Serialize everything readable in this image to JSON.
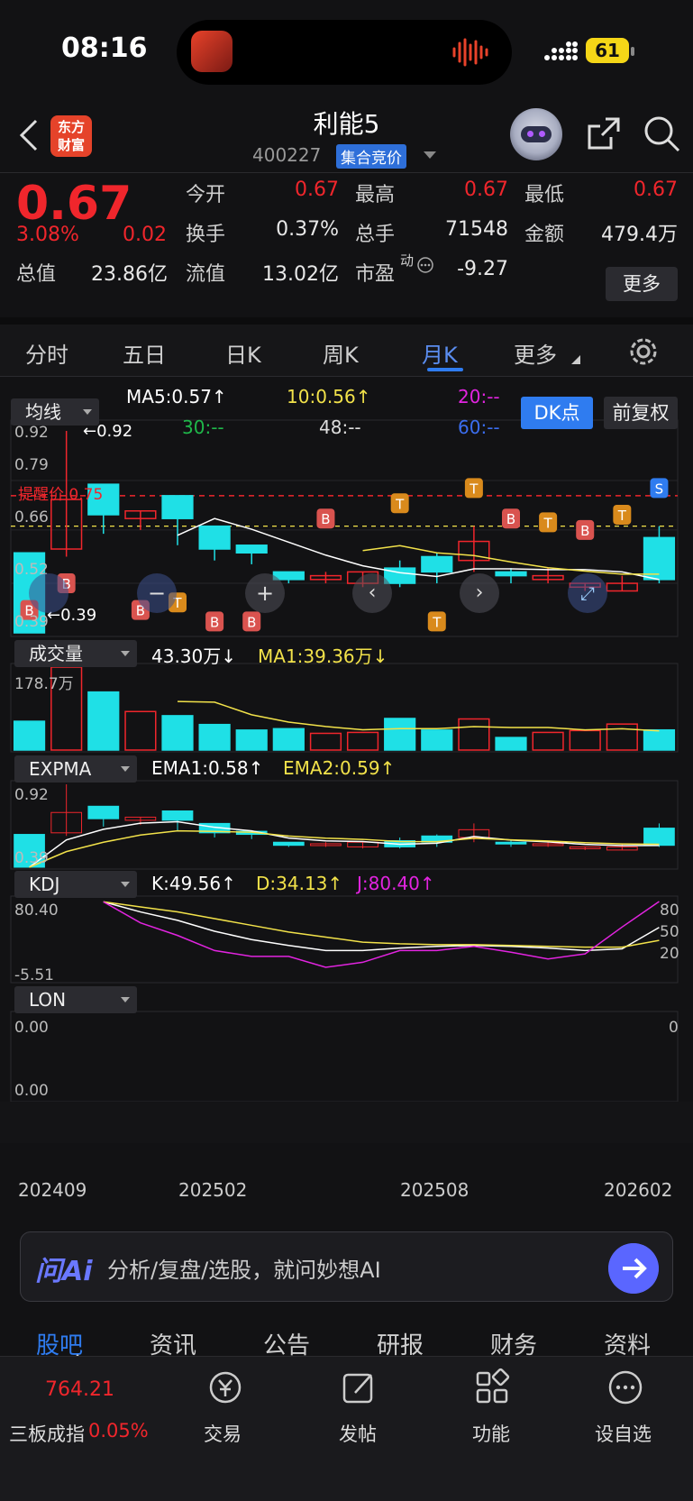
{
  "status": {
    "time": "08:16",
    "battery": "61"
  },
  "header": {
    "title": "利能5",
    "code": "400227",
    "auction_badge": "集合竞价",
    "logo_line1": "东方",
    "logo_line2": "财富"
  },
  "quote": {
    "price": "0.67",
    "change_pct": "3.08%",
    "change": "0.02",
    "open_label": "今开",
    "open": "0.67",
    "high_label": "最高",
    "high": "0.67",
    "low_label": "最低",
    "low": "0.67",
    "turnover_label": "换手",
    "turnover": "0.37%",
    "volume_label": "总手",
    "volume": "71548",
    "amount_label": "金额",
    "amount": "479.4万",
    "mktcap_label": "总值",
    "mktcap": "23.86亿",
    "float_label": "流值",
    "float_cap": "13.02亿",
    "pe_label": "市盈",
    "pe_sup": "动",
    "pe": "-9.27",
    "more_button": "更多"
  },
  "tabs": [
    "分时",
    "五日",
    "日K",
    "周K",
    "月K",
    "更多"
  ],
  "active_tab": "月K",
  "chart": {
    "ma_selector": "均线",
    "ma5": "MA5:0.57↑",
    "ma10": "10:0.56↑",
    "ma20": "20:--",
    "ma30": "30:--",
    "ma48": "48:--",
    "ma60": "60:--",
    "dk_button": "DK点",
    "adjust_button": "前复权",
    "price_axis": [
      "0.92",
      "0.79",
      "0.66",
      "0.52",
      "0.39"
    ],
    "max_marker": "←0.92",
    "min_marker": "←0.39",
    "alert_label": "提醒价 0.75",
    "vol_selector": "成交量",
    "vol_value": "43.30万↓",
    "vol_ma": "MA1:39.36万↓",
    "vol_axis": "178.7万",
    "expma_selector": "EXPMA",
    "ema1": "EMA1:0.58↑",
    "ema2": "EMA2:0.59↑",
    "expma_axis_top": "0.92",
    "expma_axis_bottom": "0.39",
    "kdj_selector": "KDJ",
    "k": "K:49.56↑",
    "d": "D:34.13↑",
    "j": "J:80.40↑",
    "kdj_axis_top": "80.40",
    "kdj_axis_bottom": "-5.51",
    "kdj_right": [
      "80",
      "50",
      "20"
    ],
    "lon_selector": "LON",
    "lon_axis_top": "0.00",
    "lon_axis_bottom": "0.00",
    "lon_right": "0",
    "x_labels": [
      "202409",
      "202502",
      "202508",
      "202602"
    ],
    "marker_labels": {
      "buy": "B",
      "sell": "S",
      "t": "T"
    }
  },
  "chart_data": {
    "type": "candlestick",
    "x": [
      "202409",
      "202410",
      "202411",
      "202412",
      "202501",
      "202502",
      "202503",
      "202504",
      "202505",
      "202506",
      "202507",
      "202508",
      "202509",
      "202510",
      "202511",
      "202512",
      "202601",
      "202602"
    ],
    "open": [
      0.6,
      0.61,
      0.78,
      0.69,
      0.75,
      0.67,
      0.62,
      0.55,
      0.53,
      0.52,
      0.56,
      0.59,
      0.58,
      0.55,
      0.53,
      0.51,
      0.5,
      0.64
    ],
    "close": [
      0.39,
      0.74,
      0.7,
      0.71,
      0.69,
      0.61,
      0.6,
      0.53,
      0.54,
      0.55,
      0.52,
      0.55,
      0.63,
      0.54,
      0.54,
      0.52,
      0.52,
      0.53
    ],
    "high": [
      0.6,
      0.92,
      0.78,
      0.71,
      0.75,
      0.67,
      0.62,
      0.55,
      0.55,
      0.55,
      0.58,
      0.6,
      0.67,
      0.56,
      0.56,
      0.52,
      0.54,
      0.67
    ],
    "low": [
      0.39,
      0.59,
      0.65,
      0.66,
      0.62,
      0.58,
      0.57,
      0.52,
      0.52,
      0.51,
      0.51,
      0.52,
      0.55,
      0.52,
      0.52,
      0.5,
      0.5,
      0.52
    ],
    "volume": [
      0.62,
      1.787,
      1.25,
      0.83,
      0.74,
      0.55,
      0.43,
      0.46,
      0.36,
      0.38,
      0.68,
      0.43,
      0.67,
      0.27,
      0.38,
      0.42,
      0.56,
      0.433
    ]
  },
  "ask_ai": {
    "logo": "问Ai",
    "placeholder": "分析/复盘/选股，就问妙想AI"
  },
  "subtabs": [
    "股吧",
    "资讯",
    "公告",
    "研报",
    "财务",
    "资料"
  ],
  "active_subtab": "股吧",
  "bottom_nav": {
    "index_value": "764.21",
    "index_name": "三板成指",
    "index_change": "0.05%",
    "trade": "交易",
    "post": "发帖",
    "function": "功能",
    "watchlist": "设自选"
  },
  "colors": {
    "up": "#f0262c",
    "down": "#1fe0e6",
    "accent": "#2f7cf0",
    "ma5": "#ffffff",
    "ma10": "#f2e24a",
    "ma20": "#e224e0",
    "ma30": "#1fb84a",
    "ma60": "#3b6ef0"
  }
}
